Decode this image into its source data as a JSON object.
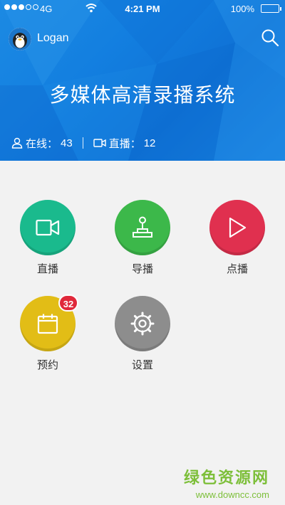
{
  "status_bar": {
    "carrier": "4G",
    "time": "4:21 PM",
    "battery": "100%",
    "signal_bars_filled": 3,
    "signal_bars_total": 5
  },
  "header": {
    "username": "Logan",
    "title": "多媒体高清录播系统",
    "avatar_icon": "penguin-avatar-icon",
    "search_icon": "search-icon"
  },
  "stats": {
    "online_label": "在线：",
    "online_count": "43",
    "live_label": "直播：",
    "live_count": "12"
  },
  "menu": [
    {
      "label": "直播",
      "icon": "video-camera-icon",
      "color": "#1aba8d"
    },
    {
      "label": "导播",
      "icon": "joystick-icon",
      "color": "#3cb84a"
    },
    {
      "label": "点播",
      "icon": "play-icon",
      "color": "#e0304f"
    },
    {
      "label": "预约",
      "icon": "calendar-icon",
      "color": "#e2bd16",
      "badge": "32"
    },
    {
      "label": "设置",
      "icon": "gear-icon",
      "color": "#8d8d8d"
    }
  ],
  "watermark": {
    "name": "绿色资源网",
    "url": "www.downcc.com"
  }
}
